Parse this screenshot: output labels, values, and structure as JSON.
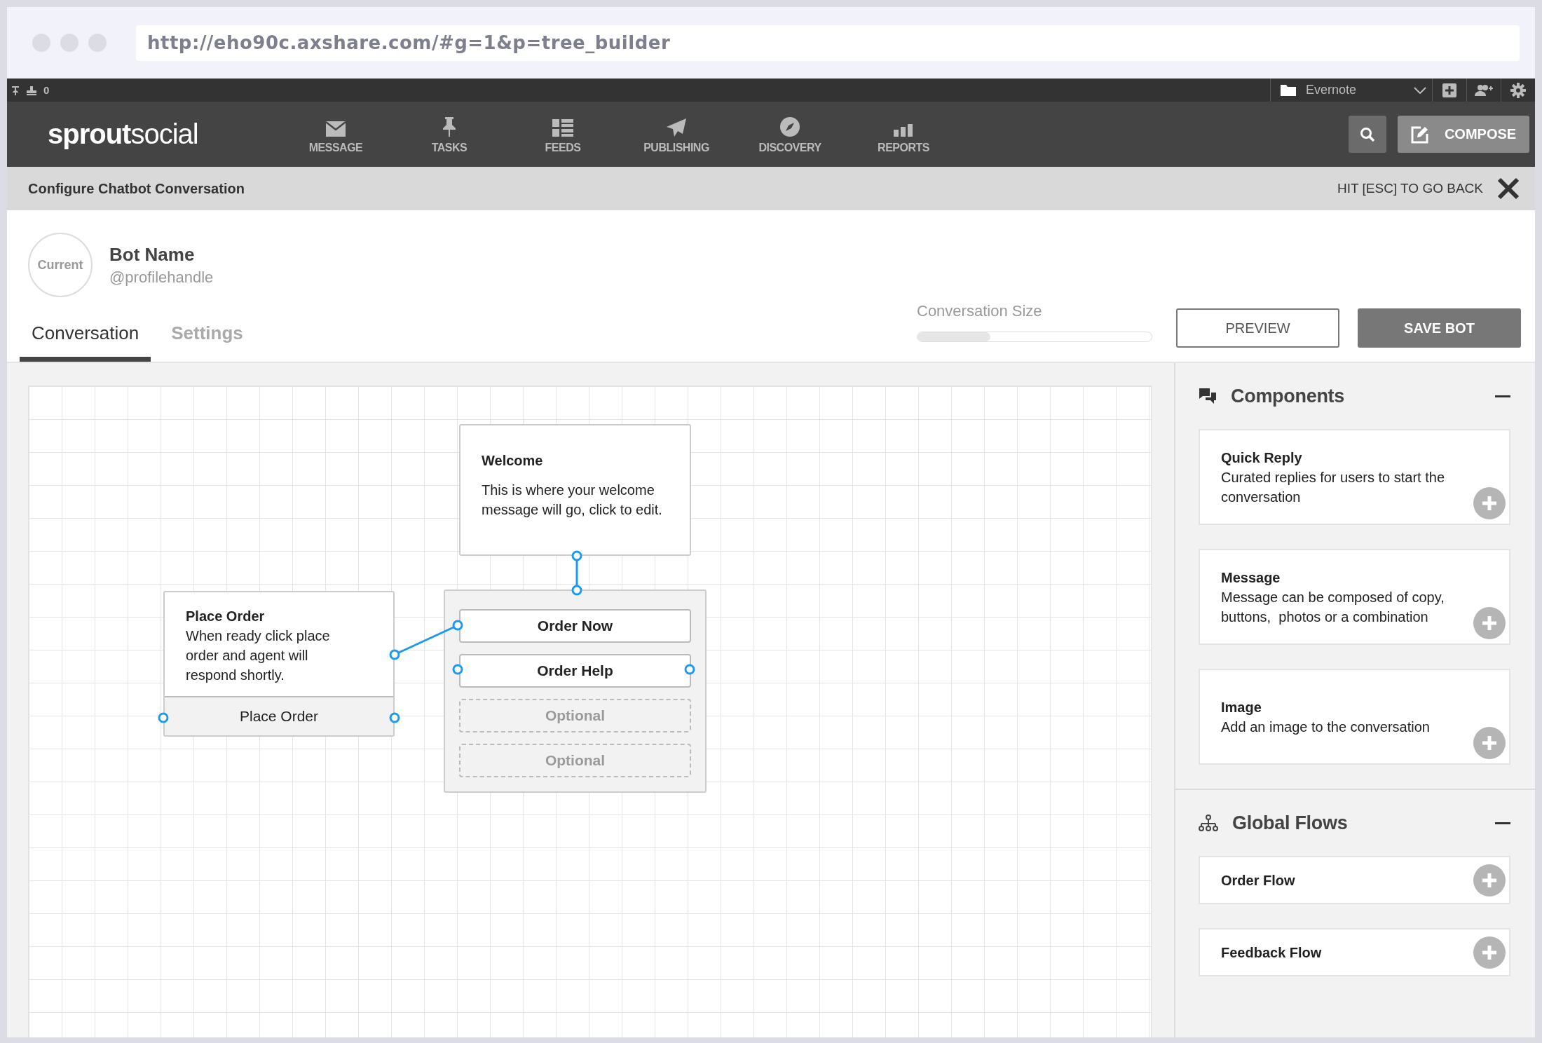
{
  "browser": {
    "url": "http://eho90c.axshare.com/#g=1&p=tree_builder"
  },
  "top_strip": {
    "count": "0",
    "account": "Evernote"
  },
  "nav": {
    "logo_bold": "sprout",
    "logo_light": "social",
    "items": [
      {
        "label": "MESSAGE",
        "kind": "message"
      },
      {
        "label": "TASKS",
        "kind": "tasks"
      },
      {
        "label": "FEEDS",
        "kind": "feeds"
      },
      {
        "label": "PUBLISHING",
        "kind": "publishing"
      },
      {
        "label": "DISCOVERY",
        "kind": "discovery"
      },
      {
        "label": "REPORTS",
        "kind": "reports"
      }
    ],
    "compose": "COMPOSE"
  },
  "header": {
    "title": "Configure Chatbot Conversation",
    "back_hint": "HIT [ESC] TO GO BACK"
  },
  "profile": {
    "avatar": "Current",
    "name": "Bot Name",
    "handle": "@profilehandle"
  },
  "tabs": [
    {
      "label": "Conversation",
      "selected": true
    },
    {
      "label": "Settings",
      "selected": false
    }
  ],
  "conversation_size": {
    "label": "Conversation Size",
    "level": 0.31
  },
  "actions": {
    "preview": "PREVIEW",
    "save": "SAVE BOT"
  },
  "canvas": {
    "welcome": {
      "title": "Welcome",
      "text": "This is where your welcome message will go, click to edit."
    },
    "place_order": {
      "title": "Place Order",
      "text": "When ready click place order and agent will respond shortly.",
      "footer": "Place Order"
    },
    "buttons": [
      {
        "label": "Order Now",
        "kind": "filled"
      },
      {
        "label": "Order Help",
        "kind": "filled"
      },
      {
        "label": "Optional",
        "kind": "optional"
      },
      {
        "label": "Optional",
        "kind": "optional"
      }
    ]
  },
  "sidebar": {
    "sections": [
      {
        "title": "Components",
        "kind": "components",
        "items": [
          {
            "title": "Quick Reply",
            "description": "Curated replies for users to start the conversation"
          },
          {
            "title": "Message",
            "description": "Message can be composed of copy, buttons,  photos or a combination"
          },
          {
            "title": "Image",
            "description": "Add an image to the conversation"
          }
        ]
      },
      {
        "title": "Global Flows",
        "kind": "flows",
        "items": [
          {
            "title": "Order Flow"
          },
          {
            "title": "Feedback Flow"
          }
        ]
      }
    ]
  }
}
